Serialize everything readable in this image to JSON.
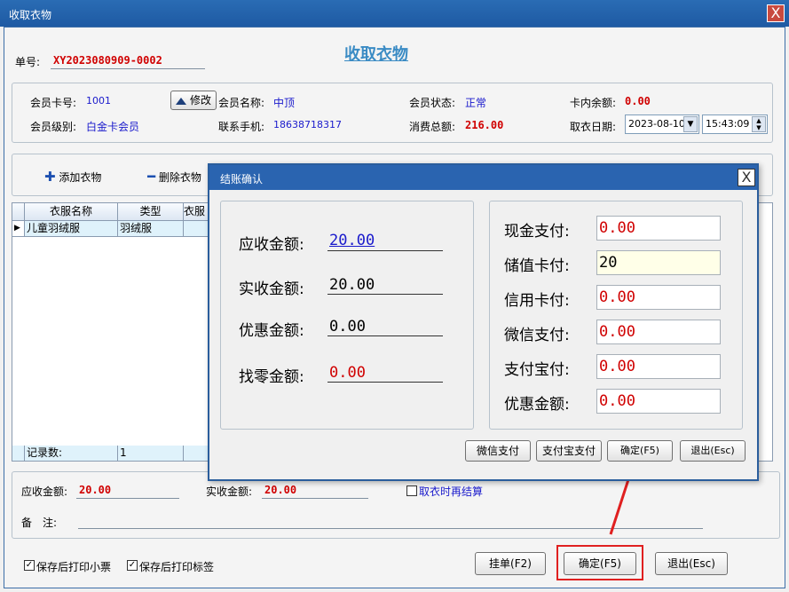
{
  "window": {
    "title": "收取衣物",
    "close": "X"
  },
  "header": {
    "order_label": "单号:",
    "order_no": "XY2023080909-0002",
    "page_title": "收取衣物"
  },
  "member": {
    "card_label": "会员卡号:",
    "card_value": "1001",
    "edit_button": "修改",
    "name_label": "会员名称:",
    "name_value": "中顶",
    "status_label": "会员状态:",
    "status_value": "正常",
    "balance_label": "卡内余额:",
    "balance_value": "0.00",
    "level_label": "会员级别:",
    "level_value": "白金卡会员",
    "phone_label": "联系手机:",
    "phone_value": "18638718317",
    "total_label": "消费总额:",
    "total_value": "216.00",
    "date_label": "取衣日期:",
    "date_value": "2023-08-10",
    "time_value": "15:43:09"
  },
  "toolbar": {
    "add_label": "添加衣物",
    "delete_label": "删除衣物"
  },
  "grid": {
    "columns": [
      "衣服名称",
      "类型",
      "衣服"
    ],
    "rows": [
      {
        "name": "儿童羽绒服",
        "type": "羽绒服",
        "extra": ""
      }
    ],
    "footer_label": "记录数:",
    "footer_count": "1",
    "row_marker": "▶"
  },
  "summary": {
    "receivable_label": "应收金额:",
    "receivable_value": "20.00",
    "received_label": "实收金额:",
    "received_value": "20.00",
    "settle_label": "取衣时再结算",
    "note_label": "备　注:"
  },
  "bottom": {
    "print_ticket_label": "保存后打印小票",
    "print_tag_label": "保存后打印标签",
    "hold_button": "挂单(F2)",
    "confirm_button": "确定(F5)",
    "exit_button": "退出(Esc)"
  },
  "modal": {
    "title": "结账确认",
    "close": "X",
    "left": {
      "receivable_label": "应收金额:",
      "receivable_value": "20.00",
      "received_label": "实收金额:",
      "received_value": "20.00",
      "discount_label": "优惠金额:",
      "discount_value": "0.00",
      "change_label": "找零金额:",
      "change_value": "0.00"
    },
    "right": {
      "cash_label": "现金支付:",
      "cash_value": "0.00",
      "stored_label": "储值卡付:",
      "stored_value": "20",
      "credit_label": "信用卡付:",
      "credit_value": "0.00",
      "wechat_label": "微信支付:",
      "wechat_value": "0.00",
      "alipay_label": "支付宝付:",
      "alipay_value": "0.00",
      "discount_label": "优惠金额:",
      "discount_value": "0.00"
    },
    "buttons": {
      "wechat": "微信支付",
      "alipay": "支付宝支付",
      "confirm": "确定(F5)",
      "exit": "退出(Esc)"
    }
  },
  "colors": {
    "highlight": "#e02020",
    "titlebar": "#2a64b0",
    "link": "#1a1acc",
    "amount": "#d00000"
  }
}
